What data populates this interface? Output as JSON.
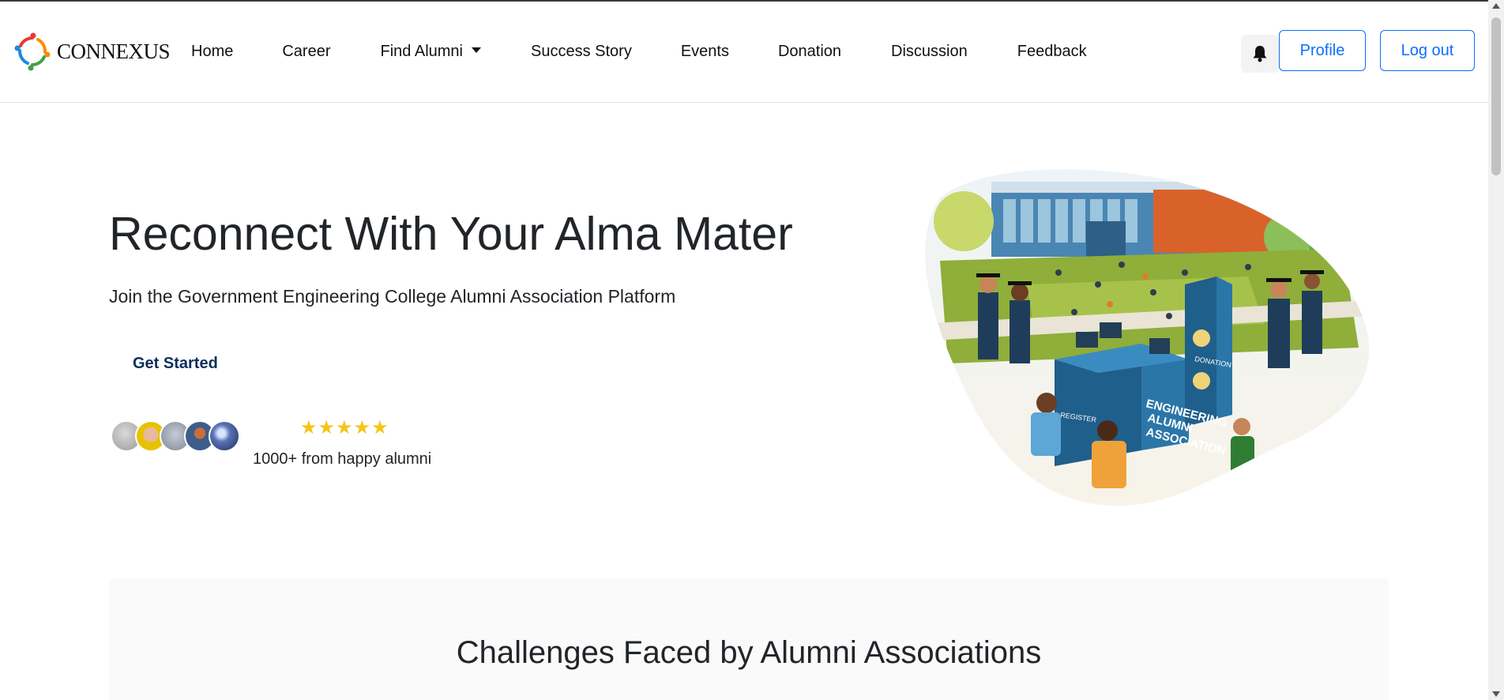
{
  "brand": {
    "name": "CONNEXUS",
    "logo_icon": "connexus-logo-icon"
  },
  "nav": {
    "items": [
      {
        "label": "Home"
      },
      {
        "label": "Career"
      },
      {
        "label": "Find Alumni",
        "has_dropdown": true
      },
      {
        "label": "Success Story"
      },
      {
        "label": "Events"
      },
      {
        "label": "Donation"
      },
      {
        "label": "Discussion"
      },
      {
        "label": "Feedback"
      }
    ],
    "notification_icon": "bell-icon",
    "profile_label": "Profile",
    "logout_label": "Log out"
  },
  "hero": {
    "title": "Reconnect With Your Alma Mater",
    "subtitle": "Join the Government Engineering College Alumni Association Platform",
    "cta_label": "Get Started",
    "rating_stars": "★★★★★",
    "rating_value": 5,
    "rating_text": "1000+ from happy alumni"
  },
  "illustration": {
    "booth_sign_lines": [
      "ENGINEERING",
      "ALUMNI",
      "ASSOCIATION"
    ],
    "register_label": "REGISTER",
    "donation_label": "DONATION"
  },
  "challenges": {
    "title": "Challenges Faced by Alumni Associations"
  },
  "colors": {
    "primary": "#0d6efd",
    "cta": "#0b2f5c",
    "star": "#f5c518",
    "booth": "#1f5f8b"
  }
}
